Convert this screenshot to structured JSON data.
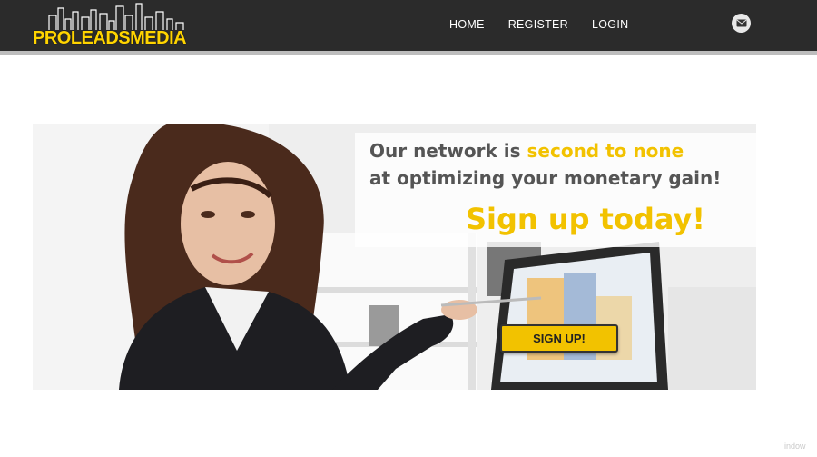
{
  "header": {
    "logo": {
      "part1": "PRO",
      "part2": "LEADS",
      "part3": "MEDIA"
    },
    "nav": [
      {
        "label": "HOME"
      },
      {
        "label": "REGISTER"
      },
      {
        "label": "LOGIN"
      }
    ],
    "mail_icon": "envelope-icon"
  },
  "hero": {
    "line1_a": "Our network is ",
    "line1_b": "second to none",
    "line2": "at optimizing your monetary gain!",
    "line3": "Sign up today!",
    "cta_label": "SIGN UP!"
  },
  "watermark": "indow",
  "colors": {
    "accent": "#f2c200",
    "header_bg": "#2b2b2b",
    "text": "#555555"
  }
}
